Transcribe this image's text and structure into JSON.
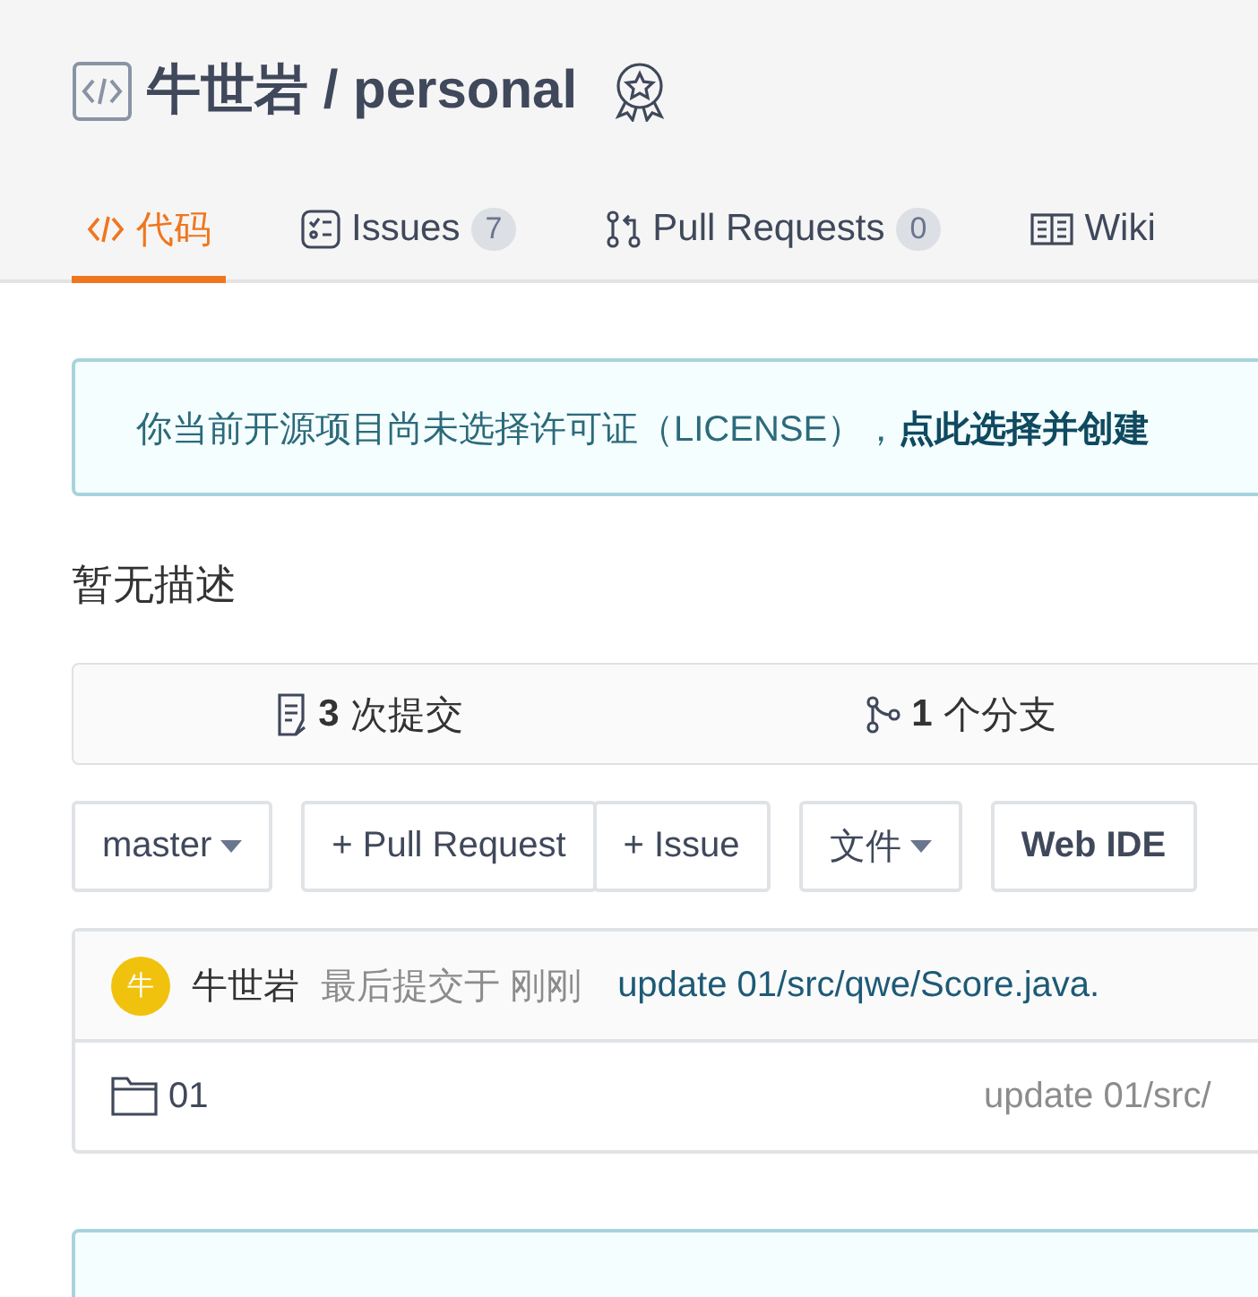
{
  "repo": {
    "owner": "牛世岩",
    "separator": "/",
    "name": "personal"
  },
  "tabs": [
    {
      "kind": "code",
      "label": "代码",
      "selected": true
    },
    {
      "kind": "issues",
      "label": "Issues",
      "count": "7",
      "selected": false
    },
    {
      "kind": "pulls",
      "label": "Pull Requests",
      "count": "0",
      "selected": false
    },
    {
      "kind": "wiki",
      "label": "Wiki",
      "selected": false
    }
  ],
  "license_notice": {
    "text": "你当前开源项目尚未选择许可证（LICENSE），",
    "link": "点此选择并创建"
  },
  "description": "暂无描述",
  "stats": [
    {
      "kind": "commits",
      "count": "3",
      "label": "次提交"
    },
    {
      "kind": "branches",
      "count": "1",
      "label": "个分支"
    }
  ],
  "toolbar": {
    "branch": "master",
    "new_pull": "+ Pull Request",
    "new_issue": "+ Issue",
    "file_menu": "文件",
    "web_ide": "Web IDE"
  },
  "last_commit": {
    "avatar": "牛",
    "author": "牛世岩",
    "time": "最后提交于 刚刚",
    "message": "update 01/src/qwe/Score.java."
  },
  "files": [
    {
      "kind": "folder",
      "name": "01",
      "message": "update 01/src/"
    }
  ]
}
